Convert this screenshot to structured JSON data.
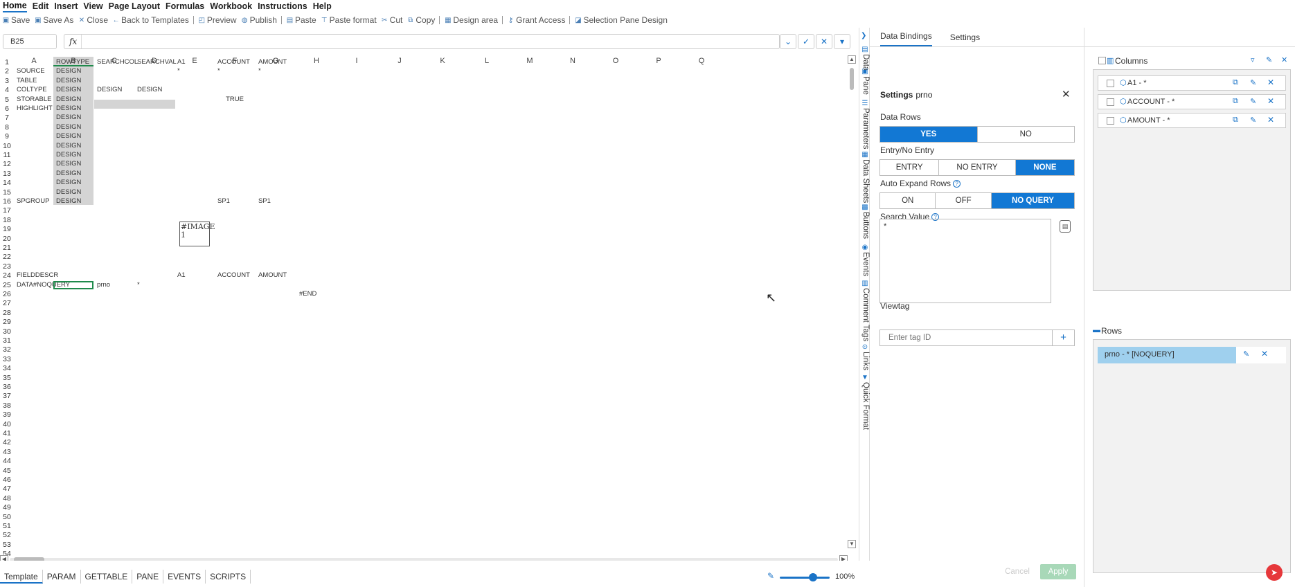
{
  "menu": [
    "Home",
    "Edit",
    "Insert",
    "View",
    "Page Layout",
    "Formulas",
    "Workbook",
    "Instructions",
    "Help"
  ],
  "toolbar": {
    "save": "Save",
    "save_as": "Save As",
    "close": "Close",
    "back": "Back to Templates",
    "preview": "Preview",
    "publish": "Publish",
    "paste": "Paste",
    "paste_format": "Paste format",
    "cut": "Cut",
    "copy": "Copy",
    "design_area": "Design area",
    "grant_access": "Grant Access",
    "selection_pane": "Selection Pane Design"
  },
  "formula": {
    "cell_ref": "B25",
    "fx_label": "fx",
    "value": ""
  },
  "grid": {
    "columns": [
      "A",
      "B",
      "C",
      "D",
      "E",
      "F",
      "G",
      "H",
      "I",
      "J",
      "K",
      "L",
      "M",
      "N",
      "O",
      "P",
      "Q"
    ],
    "selected_column": "B",
    "rows": [
      "1",
      "2",
      "3",
      "4",
      "5",
      "6",
      "7",
      "8",
      "9",
      "10",
      "11",
      "12",
      "13",
      "14",
      "15",
      "16",
      "17",
      "18",
      "19",
      "20",
      "21",
      "22",
      "23",
      "24",
      "25",
      "26",
      "27",
      "28",
      "29",
      "30",
      "31",
      "32",
      "33",
      "34",
      "35",
      "36",
      "37",
      "38",
      "39",
      "40",
      "41",
      "42",
      "43",
      "44",
      "45",
      "46",
      "47",
      "48",
      "49",
      "50",
      "51",
      "52",
      "53",
      "54"
    ],
    "cells": [
      {
        "row": 1,
        "col": "B",
        "v": "ROWTYPE"
      },
      {
        "row": 1,
        "col": "C",
        "v": "SEARCHCOL"
      },
      {
        "row": 1,
        "col": "D",
        "v": "SEARCHVAL"
      },
      {
        "row": 1,
        "col": "E",
        "v": "A1"
      },
      {
        "row": 1,
        "col": "F",
        "v": "ACCOUNT"
      },
      {
        "row": 1,
        "col": "G",
        "v": "AMOUNT"
      },
      {
        "row": 2,
        "col": "A",
        "v": "SOURCE"
      },
      {
        "row": 2,
        "col": "B",
        "v": "DESIGN"
      },
      {
        "row": 2,
        "col": "E",
        "v": "*"
      },
      {
        "row": 2,
        "col": "F",
        "v": "*"
      },
      {
        "row": 2,
        "col": "G",
        "v": "*"
      },
      {
        "row": 3,
        "col": "A",
        "v": "TABLE"
      },
      {
        "row": 3,
        "col": "B",
        "v": "DESIGN"
      },
      {
        "row": 4,
        "col": "A",
        "v": "COLTYPE"
      },
      {
        "row": 4,
        "col": "B",
        "v": "DESIGN"
      },
      {
        "row": 4,
        "col": "C",
        "v": "DESIGN"
      },
      {
        "row": 4,
        "col": "D",
        "v": "DESIGN"
      },
      {
        "row": 5,
        "col": "A",
        "v": "STORABLE"
      },
      {
        "row": 5,
        "col": "B",
        "v": "DESIGN"
      },
      {
        "row": 5,
        "col": "F",
        "v": "TRUE",
        "center": true
      },
      {
        "row": 6,
        "col": "A",
        "v": "HIGHLIGHT"
      },
      {
        "row": 6,
        "col": "B",
        "v": "DESIGN"
      },
      {
        "row": 7,
        "col": "B",
        "v": "DESIGN"
      },
      {
        "row": 8,
        "col": "B",
        "v": "DESIGN"
      },
      {
        "row": 9,
        "col": "B",
        "v": "DESIGN"
      },
      {
        "row": 10,
        "col": "B",
        "v": "DESIGN"
      },
      {
        "row": 11,
        "col": "B",
        "v": "DESIGN"
      },
      {
        "row": 12,
        "col": "B",
        "v": "DESIGN"
      },
      {
        "row": 13,
        "col": "B",
        "v": "DESIGN"
      },
      {
        "row": 14,
        "col": "B",
        "v": "DESIGN"
      },
      {
        "row": 15,
        "col": "B",
        "v": "DESIGN"
      },
      {
        "row": 16,
        "col": "A",
        "v": "SPGROUP"
      },
      {
        "row": 16,
        "col": "B",
        "v": "DESIGN"
      },
      {
        "row": 16,
        "col": "F",
        "v": "SP1"
      },
      {
        "row": 16,
        "col": "G",
        "v": "SP1"
      },
      {
        "row": 24,
        "col": "A",
        "v": "FIELDDESCR"
      },
      {
        "row": 24,
        "col": "E",
        "v": "A1"
      },
      {
        "row": 24,
        "col": "F",
        "v": "ACCOUNT"
      },
      {
        "row": 24,
        "col": "G",
        "v": "AMOUNT"
      },
      {
        "row": 25,
        "col": "A",
        "v": "DATA#NOQUERY"
      },
      {
        "row": 25,
        "col": "C",
        "v": "prno"
      },
      {
        "row": 25,
        "col": "D",
        "v": "*"
      },
      {
        "row": 26,
        "col": "H",
        "v": "#END"
      }
    ],
    "image_label": "#IMAGE\n1"
  },
  "sheet_tabs": [
    "Template",
    "PARAM",
    "GETTABLE",
    "PANE",
    "EVENTS",
    "SCRIPTS"
  ],
  "zoom": {
    "percent": "100%",
    "level": 0.7
  },
  "side_tabs": [
    "Data",
    "Pane",
    "Parameters",
    "Data Sheets",
    "Buttons",
    "Events",
    "Comment Tags",
    "Links",
    "Quick Format"
  ],
  "panel_tabs": [
    "Data Bindings",
    "Settings"
  ],
  "settings": {
    "title": "Settings",
    "name": "prno",
    "data_rows_label": "Data Rows",
    "data_rows_options": [
      "YES",
      "NO"
    ],
    "data_rows_selected": "YES",
    "entry_label": "Entry/No Entry",
    "entry_options": [
      "ENTRY",
      "NO ENTRY",
      "NONE"
    ],
    "entry_selected": "NONE",
    "auto_expand_label": "Auto Expand Rows",
    "auto_expand_options": [
      "ON",
      "OFF",
      "NO QUERY"
    ],
    "auto_expand_selected": "NO QUERY",
    "search_value_label": "Search Value",
    "search_value": "*",
    "viewtag_label": "Viewtag",
    "viewtag_placeholder": "Enter tag ID",
    "cancel": "Cancel",
    "apply": "Apply"
  },
  "columns_panel": {
    "title": "Columns",
    "items": [
      "A1 - *",
      "ACCOUNT - *",
      "AMOUNT - *"
    ]
  },
  "rows_panel": {
    "title": "Rows",
    "items": [
      "prno - * [NOQUERY]"
    ]
  },
  "colors": {
    "accent": "#1278d4",
    "active_cell": "#1f8a4c",
    "shade": "#d4d4d4",
    "row_selected": "#9fd0ee",
    "apply_disabled": "#a8d8b8",
    "fab": "#e6383b"
  }
}
